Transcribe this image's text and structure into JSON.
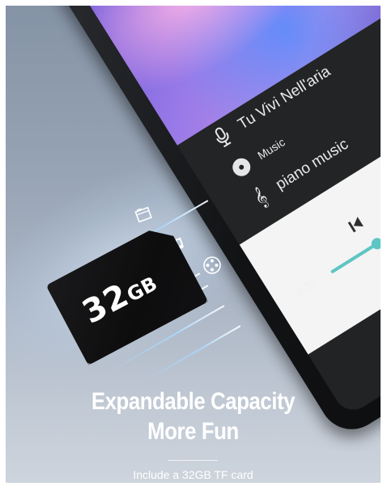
{
  "player": {
    "track_title": "Tu Vivi Nell'aria",
    "category": "Music",
    "playlist": "piano music",
    "elapsed": "0:39",
    "progress_fraction": 0.35
  },
  "card": {
    "capacity_number": "32",
    "capacity_unit": "GB"
  },
  "promo": {
    "headline_line1": "Expandable Capacity",
    "headline_line2": "More Fun",
    "caption": "Include a 32GB TF card"
  },
  "icons": {
    "title_icon": "microphone-icon",
    "category_icon": "disc-icon",
    "playlist_icon": "treble-clef-icon",
    "prev": "skip-previous-icon",
    "pause": "pause-icon",
    "home": "home-square-icon",
    "folder": "folder-icon",
    "note": "music-note-icon",
    "reel": "film-reel-icon"
  },
  "colors": {
    "accent": "#5dc6c4",
    "screen_dark": "#232425",
    "player_light": "#f4f4f5"
  }
}
